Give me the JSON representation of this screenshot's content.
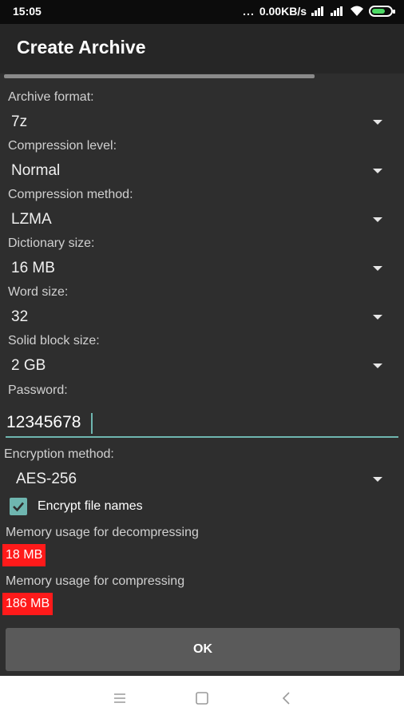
{
  "status_bar": {
    "time": "15:05",
    "dots": "...",
    "speed": "0.00KB/s",
    "battery_color": "#4cd964"
  },
  "dialog": {
    "title": "Create Archive",
    "fields": [
      {
        "label": "Archive format:",
        "value": "7z"
      },
      {
        "label": "Compression level:",
        "value": "Normal"
      },
      {
        "label": "Compression method:",
        "value": "LZMA"
      },
      {
        "label": "Dictionary size:",
        "value": "16 MB"
      },
      {
        "label": "Word size:",
        "value": "32"
      },
      {
        "label": "Solid block size:",
        "value": "2 GB"
      }
    ],
    "password_label": "Password:",
    "password_value": "12345678",
    "encryption_label": "Encryption method:",
    "encryption_value": "AES-256",
    "encrypt_names_label": "Encrypt file names",
    "encrypt_names_checked": true,
    "memory_decompress_label": "Memory usage for decompressing",
    "memory_decompress_value": "18 MB",
    "memory_compress_label": "Memory usage for compressing",
    "memory_compress_value": "186 MB",
    "ok_label": "OK"
  },
  "colors": {
    "accent": "#6fb6b0",
    "warning": "#ff1a1a"
  },
  "nav": {
    "icons": [
      "menu-icon",
      "home-square-icon",
      "back-icon"
    ]
  }
}
